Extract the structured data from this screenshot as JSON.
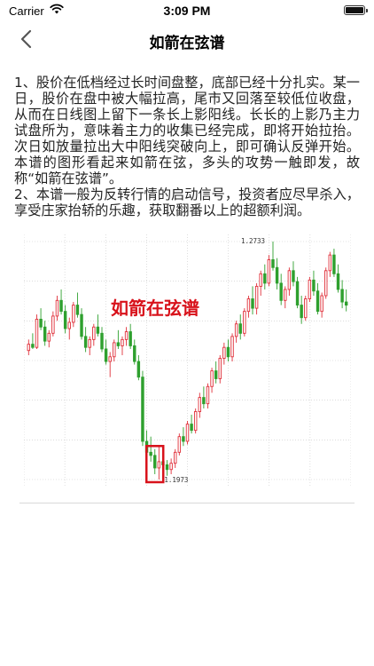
{
  "status_bar": {
    "carrier": "Carrier",
    "time": "3:09 PM"
  },
  "nav": {
    "title": "如箭在弦谱"
  },
  "article": {
    "paragraph1": "1、股价在低档经过长时间盘整，底部已经十分扎实。某一日，股价在盘中被大幅拉高，尾市又回落至较低位收盘，从而在日线图上留下一条长上影阳线。长长的上影乃主力试盘所为，意味着主力的收集已经完成，即将开始拉抬。次日如放量拉出大中阳线突破向上，即可确认反弹开始。本谱的图形看起来如箭在弦，多头的攻势一触即发，故称“如箭在弦谱”。",
    "paragraph2": "2、本谱一般为反转行情的启动信号，投资者应尽早杀入， 享受庄家抬轿的乐趣，获取翻番以上的超额利润。"
  },
  "chart_data": {
    "type": "candlestick",
    "title": "如箭在弦谱",
    "high_label": "1.2733",
    "low_label": "1.1973",
    "ylim": [
      1.1973,
      1.2733
    ],
    "colors": {
      "up": "#e0303a",
      "down": "#2ea02e",
      "title": "#d8121b",
      "highlight": "#d8121b"
    },
    "candles": [
      [
        1.2385,
        1.242,
        1.237,
        1.2405
      ],
      [
        1.2405,
        1.244,
        1.239,
        1.2395
      ],
      [
        1.2395,
        1.25,
        1.239,
        1.2485
      ],
      [
        1.2485,
        1.252,
        1.245,
        1.246
      ],
      [
        1.246,
        1.248,
        1.24,
        1.2415
      ],
      [
        1.2415,
        1.245,
        1.2395,
        1.244
      ],
      [
        1.244,
        1.251,
        1.243,
        1.2495
      ],
      [
        1.2495,
        1.256,
        1.248,
        1.2545
      ],
      [
        1.2545,
        1.258,
        1.25,
        1.251
      ],
      [
        1.251,
        1.253,
        1.244,
        1.2455
      ],
      [
        1.2455,
        1.249,
        1.242,
        1.2475
      ],
      [
        1.2475,
        1.254,
        1.246,
        1.253
      ],
      [
        1.253,
        1.257,
        1.249,
        1.25
      ],
      [
        1.25,
        1.252,
        1.242,
        1.243
      ],
      [
        1.243,
        1.246,
        1.238,
        1.2395
      ],
      [
        1.2395,
        1.243,
        1.237,
        1.242
      ],
      [
        1.242,
        1.247,
        1.24,
        1.246
      ],
      [
        1.246,
        1.25,
        1.243,
        1.244
      ],
      [
        1.244,
        1.246,
        1.238,
        1.239
      ],
      [
        1.239,
        1.242,
        1.234,
        1.235
      ],
      [
        1.235,
        1.238,
        1.23,
        1.2365
      ],
      [
        1.2365,
        1.242,
        1.235,
        1.241
      ],
      [
        1.241,
        1.245,
        1.239,
        1.24
      ],
      [
        1.24,
        1.243,
        1.237,
        1.242
      ],
      [
        1.242,
        1.246,
        1.24,
        1.2445
      ],
      [
        1.2445,
        1.247,
        1.239,
        1.24
      ],
      [
        1.24,
        1.242,
        1.234,
        1.235
      ],
      [
        1.235,
        1.237,
        1.229,
        1.23
      ],
      [
        1.23,
        1.232,
        1.208,
        1.2095
      ],
      [
        1.2095,
        1.213,
        1.204,
        1.206
      ],
      [
        1.206,
        1.211,
        1.203,
        1.205
      ],
      [
        1.205,
        1.207,
        1.199,
        1.201
      ],
      [
        1.201,
        1.208,
        1.1973,
        1.203
      ],
      [
        1.203,
        1.2045,
        1.2,
        1.202
      ],
      [
        1.202,
        1.2035,
        1.1985,
        1.2005
      ],
      [
        1.2005,
        1.204,
        1.199,
        1.2025
      ],
      [
        1.2025,
        1.207,
        1.201,
        1.206
      ],
      [
        1.206,
        1.212,
        1.205,
        1.211
      ],
      [
        1.211,
        1.214,
        1.208,
        1.2095
      ],
      [
        1.2095,
        1.216,
        1.2085,
        1.215
      ],
      [
        1.215,
        1.218,
        1.212,
        1.213
      ],
      [
        1.213,
        1.22,
        1.212,
        1.219
      ],
      [
        1.219,
        1.225,
        1.217,
        1.2235
      ],
      [
        1.2235,
        1.227,
        1.22,
        1.2215
      ],
      [
        1.2215,
        1.228,
        1.22,
        1.227
      ],
      [
        1.227,
        1.233,
        1.225,
        1.232
      ],
      [
        1.232,
        1.235,
        1.228,
        1.2295
      ],
      [
        1.2295,
        1.237,
        1.228,
        1.236
      ],
      [
        1.236,
        1.241,
        1.234,
        1.2395
      ],
      [
        1.2395,
        1.242,
        1.235,
        1.2365
      ],
      [
        1.2365,
        1.244,
        1.235,
        1.243
      ],
      [
        1.243,
        1.248,
        1.241,
        1.247
      ],
      [
        1.247,
        1.25,
        1.242,
        1.244
      ],
      [
        1.244,
        1.252,
        1.243,
        1.251
      ],
      [
        1.251,
        1.256,
        1.249,
        1.255
      ],
      [
        1.255,
        1.259,
        1.25,
        1.252
      ],
      [
        1.252,
        1.26,
        1.25,
        1.259
      ],
      [
        1.259,
        1.264,
        1.256,
        1.263
      ],
      [
        1.263,
        1.266,
        1.258,
        1.26
      ],
      [
        1.26,
        1.269,
        1.259,
        1.2675
      ],
      [
        1.2675,
        1.2733,
        1.264,
        1.265
      ],
      [
        1.265,
        1.268,
        1.258,
        1.26
      ],
      [
        1.26,
        1.263,
        1.253,
        1.2545
      ],
      [
        1.2545,
        1.259,
        1.252,
        1.258
      ],
      [
        1.258,
        1.265,
        1.256,
        1.264
      ],
      [
        1.264,
        1.267,
        1.259,
        1.2605
      ],
      [
        1.2605,
        1.262,
        1.252,
        1.253
      ],
      [
        1.253,
        1.256,
        1.247,
        1.249
      ],
      [
        1.249,
        1.256,
        1.248,
        1.255
      ],
      [
        1.255,
        1.262,
        1.254,
        1.261
      ],
      [
        1.261,
        1.264,
        1.256,
        1.2575
      ],
      [
        1.2575,
        1.26,
        1.25,
        1.251
      ],
      [
        1.251,
        1.257,
        1.249,
        1.256
      ],
      [
        1.256,
        1.265,
        1.255,
        1.264
      ],
      [
        1.264,
        1.27,
        1.262,
        1.269
      ],
      [
        1.269,
        1.271,
        1.262,
        1.263
      ],
      [
        1.263,
        1.266,
        1.257,
        1.258
      ],
      [
        1.258,
        1.261,
        1.252,
        1.254
      ],
      [
        1.254,
        1.258,
        1.251,
        1.253
      ]
    ]
  }
}
